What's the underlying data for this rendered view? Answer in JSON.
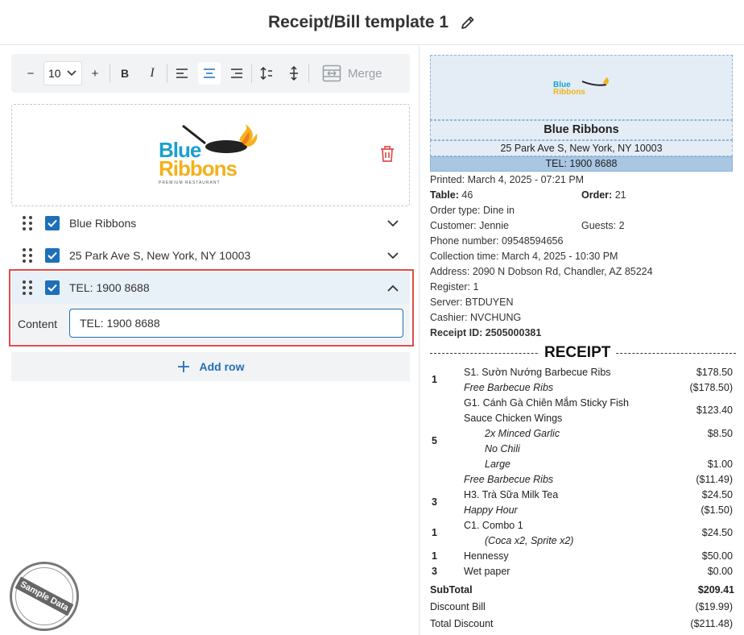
{
  "header": {
    "title": "Receipt/Bill template 1"
  },
  "toolbar": {
    "font_size": "10",
    "minus": "−",
    "plus": "+",
    "bold": "B",
    "italic": "I",
    "merge_label": "Merge"
  },
  "logo": {
    "line1": "Blue",
    "line2": "Ribbons",
    "tagline": "PREMIUM RESTAURANT"
  },
  "rows": [
    {
      "label": "Blue Ribbons"
    },
    {
      "label": "25 Park Ave S, New York, NY 10003"
    },
    {
      "label": "TEL: 1900 8688"
    }
  ],
  "editor": {
    "content_label": "Content",
    "content_value": "TEL: 1900 8688"
  },
  "add_row_label": "Add row",
  "stamp_text": "Sample Data",
  "receipt": {
    "logo_line1": "Blue",
    "logo_line2": "Ribbons",
    "name": "Blue Ribbons",
    "address": "25 Park Ave S, New York, NY 10003",
    "tel": "TEL: 1900 8688",
    "printed_label": "Printed:",
    "printed": "March 4, 2025 - 07:21 PM",
    "table_label": "Table:",
    "table": "46",
    "order_label": "Order:",
    "order": "21",
    "order_type_label": "Order type:",
    "order_type": "Dine in",
    "customer_label": "Customer:",
    "customer": "Jennie",
    "guests_label": "Guests:",
    "guests": "2",
    "phone_label": "Phone number:",
    "phone": "09548594656",
    "collection_label": "Collection time:",
    "collection": "March 4, 2025 - 10:30 PM",
    "address_label": "Address:",
    "address_val": "2090 N Dobson Rd, Chandler, AZ 85224",
    "register_label": "Register:",
    "register": "1",
    "server_label": "Server:",
    "server": "BTDUYEN",
    "cashier_label": "Cashier:",
    "cashier": "NVCHUNG",
    "receipt_id_label": "Receipt ID:",
    "receipt_id": "2505000381",
    "section": "RECEIPT",
    "items": {
      "q1": "1",
      "i1": "S1. Sườn Nướng Barbecue Ribs",
      "p1": "$178.50",
      "i1b": "Free Barbecue Ribs",
      "p1b": "($178.50)",
      "i2a": "G1. Cánh Gà Chiên Mắm Sticky Fish",
      "i2b": "Sauce Chicken Wings",
      "p2": "$123.40",
      "q2": "5",
      "m1": "2x Minced Garlic",
      "pm1": "$8.50",
      "m2": "No Chili",
      "m3": "Large",
      "pm3": "$1.00",
      "i2c": "Free Barbecue Ribs",
      "p2c": "($11.49)",
      "q3": "3",
      "i3": "H3. Trà Sữa Milk Tea",
      "p3": "$24.50",
      "i3b": "Happy Hour",
      "p3b": "($1.50)",
      "q4": "1",
      "i4": "C1. Combo 1",
      "i4b": "(Coca x2, Sprite x2)",
      "p4": "$24.50",
      "q5": "1",
      "i5": "Hennessy",
      "p5": "$50.00",
      "q6": "3",
      "i6": "Wet paper",
      "p6": "$0.00"
    },
    "subtotal_label": "SubTotal",
    "subtotal": "$209.41",
    "discount_bill_label": "Discount Bill",
    "discount_bill": "($19.99)",
    "total_discount_label": "Total Discount",
    "total_discount": "($211.48)"
  }
}
